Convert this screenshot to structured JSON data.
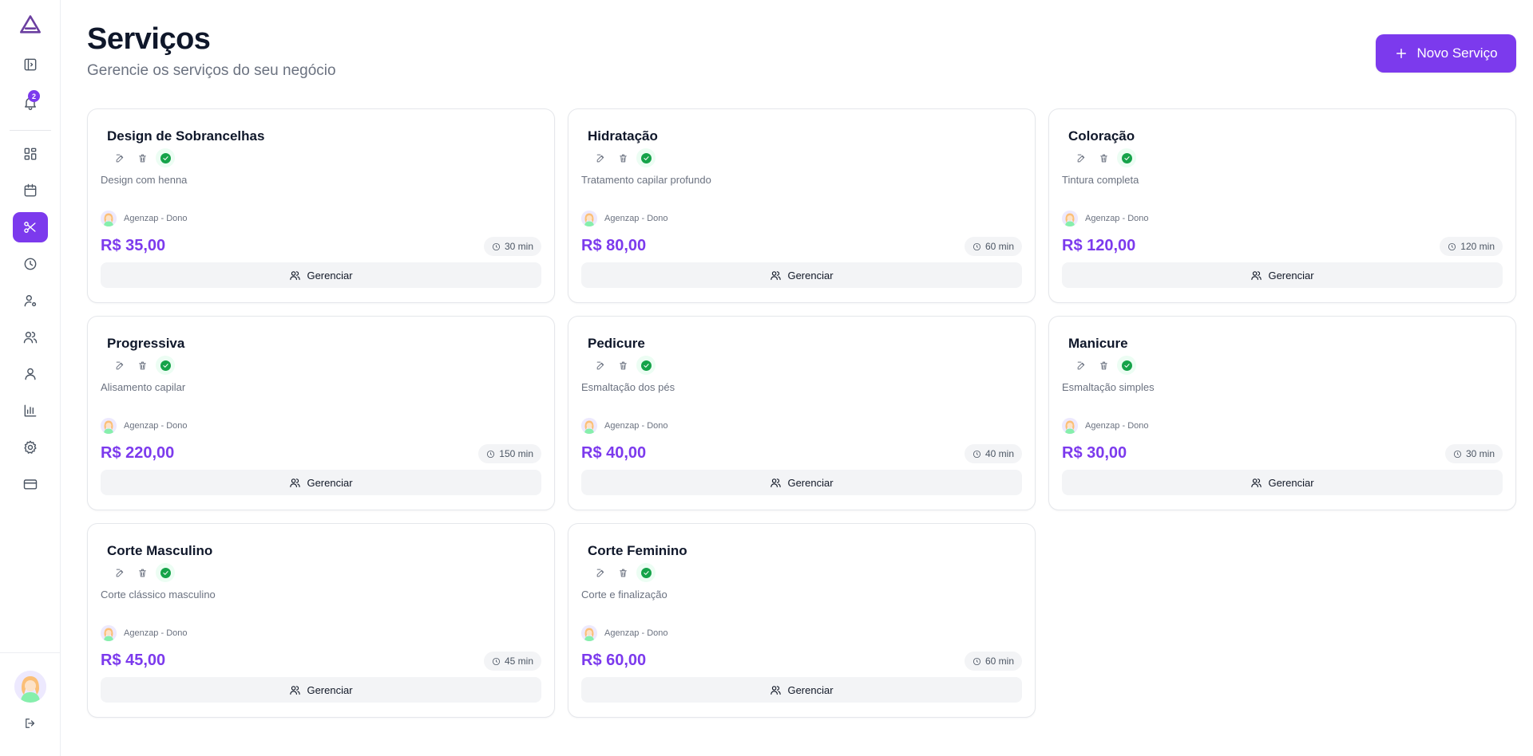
{
  "sidebar": {
    "notification_count": "2",
    "items": [
      {
        "icon": "dashboard-icon"
      },
      {
        "icon": "calendar-icon"
      },
      {
        "icon": "scissors-icon",
        "active": true
      },
      {
        "icon": "clock-icon"
      },
      {
        "icon": "user-settings-icon"
      },
      {
        "icon": "users-icon"
      },
      {
        "icon": "user-icon"
      },
      {
        "icon": "bar-chart-icon"
      },
      {
        "icon": "gear-icon"
      },
      {
        "icon": "credit-card-icon"
      }
    ]
  },
  "header": {
    "title": "Serviços",
    "subtitle": "Gerencie os serviços do seu negócio",
    "new_button_label": "Novo Serviço"
  },
  "colors": {
    "accent": "#7c3aed",
    "success": "#16a34a"
  },
  "services": [
    {
      "name": "Design de Sobrancelhas",
      "description": "Design com henna",
      "owner": "Agenzap - Dono",
      "price": "R$ 35,00",
      "duration": "30 min",
      "manage_label": "Gerenciar"
    },
    {
      "name": "Hidratação",
      "description": "Tratamento capilar profundo",
      "owner": "Agenzap - Dono",
      "price": "R$ 80,00",
      "duration": "60 min",
      "manage_label": "Gerenciar"
    },
    {
      "name": "Coloração",
      "description": "Tintura completa",
      "owner": "Agenzap - Dono",
      "price": "R$ 120,00",
      "duration": "120 min",
      "manage_label": "Gerenciar"
    },
    {
      "name": "Progressiva",
      "description": "Alisamento capilar",
      "owner": "Agenzap - Dono",
      "price": "R$ 220,00",
      "duration": "150 min",
      "manage_label": "Gerenciar"
    },
    {
      "name": "Pedicure",
      "description": "Esmaltação dos pés",
      "owner": "Agenzap - Dono",
      "price": "R$ 40,00",
      "duration": "40 min",
      "manage_label": "Gerenciar"
    },
    {
      "name": "Manicure",
      "description": "Esmaltação simples",
      "owner": "Agenzap - Dono",
      "price": "R$ 30,00",
      "duration": "30 min",
      "manage_label": "Gerenciar"
    },
    {
      "name": "Corte Masculino",
      "description": "Corte clássico masculino",
      "owner": "Agenzap - Dono",
      "price": "R$ 45,00",
      "duration": "45 min",
      "manage_label": "Gerenciar"
    },
    {
      "name": "Corte Feminino",
      "description": "Corte e finalização",
      "owner": "Agenzap - Dono",
      "price": "R$ 60,00",
      "duration": "60 min",
      "manage_label": "Gerenciar"
    }
  ]
}
